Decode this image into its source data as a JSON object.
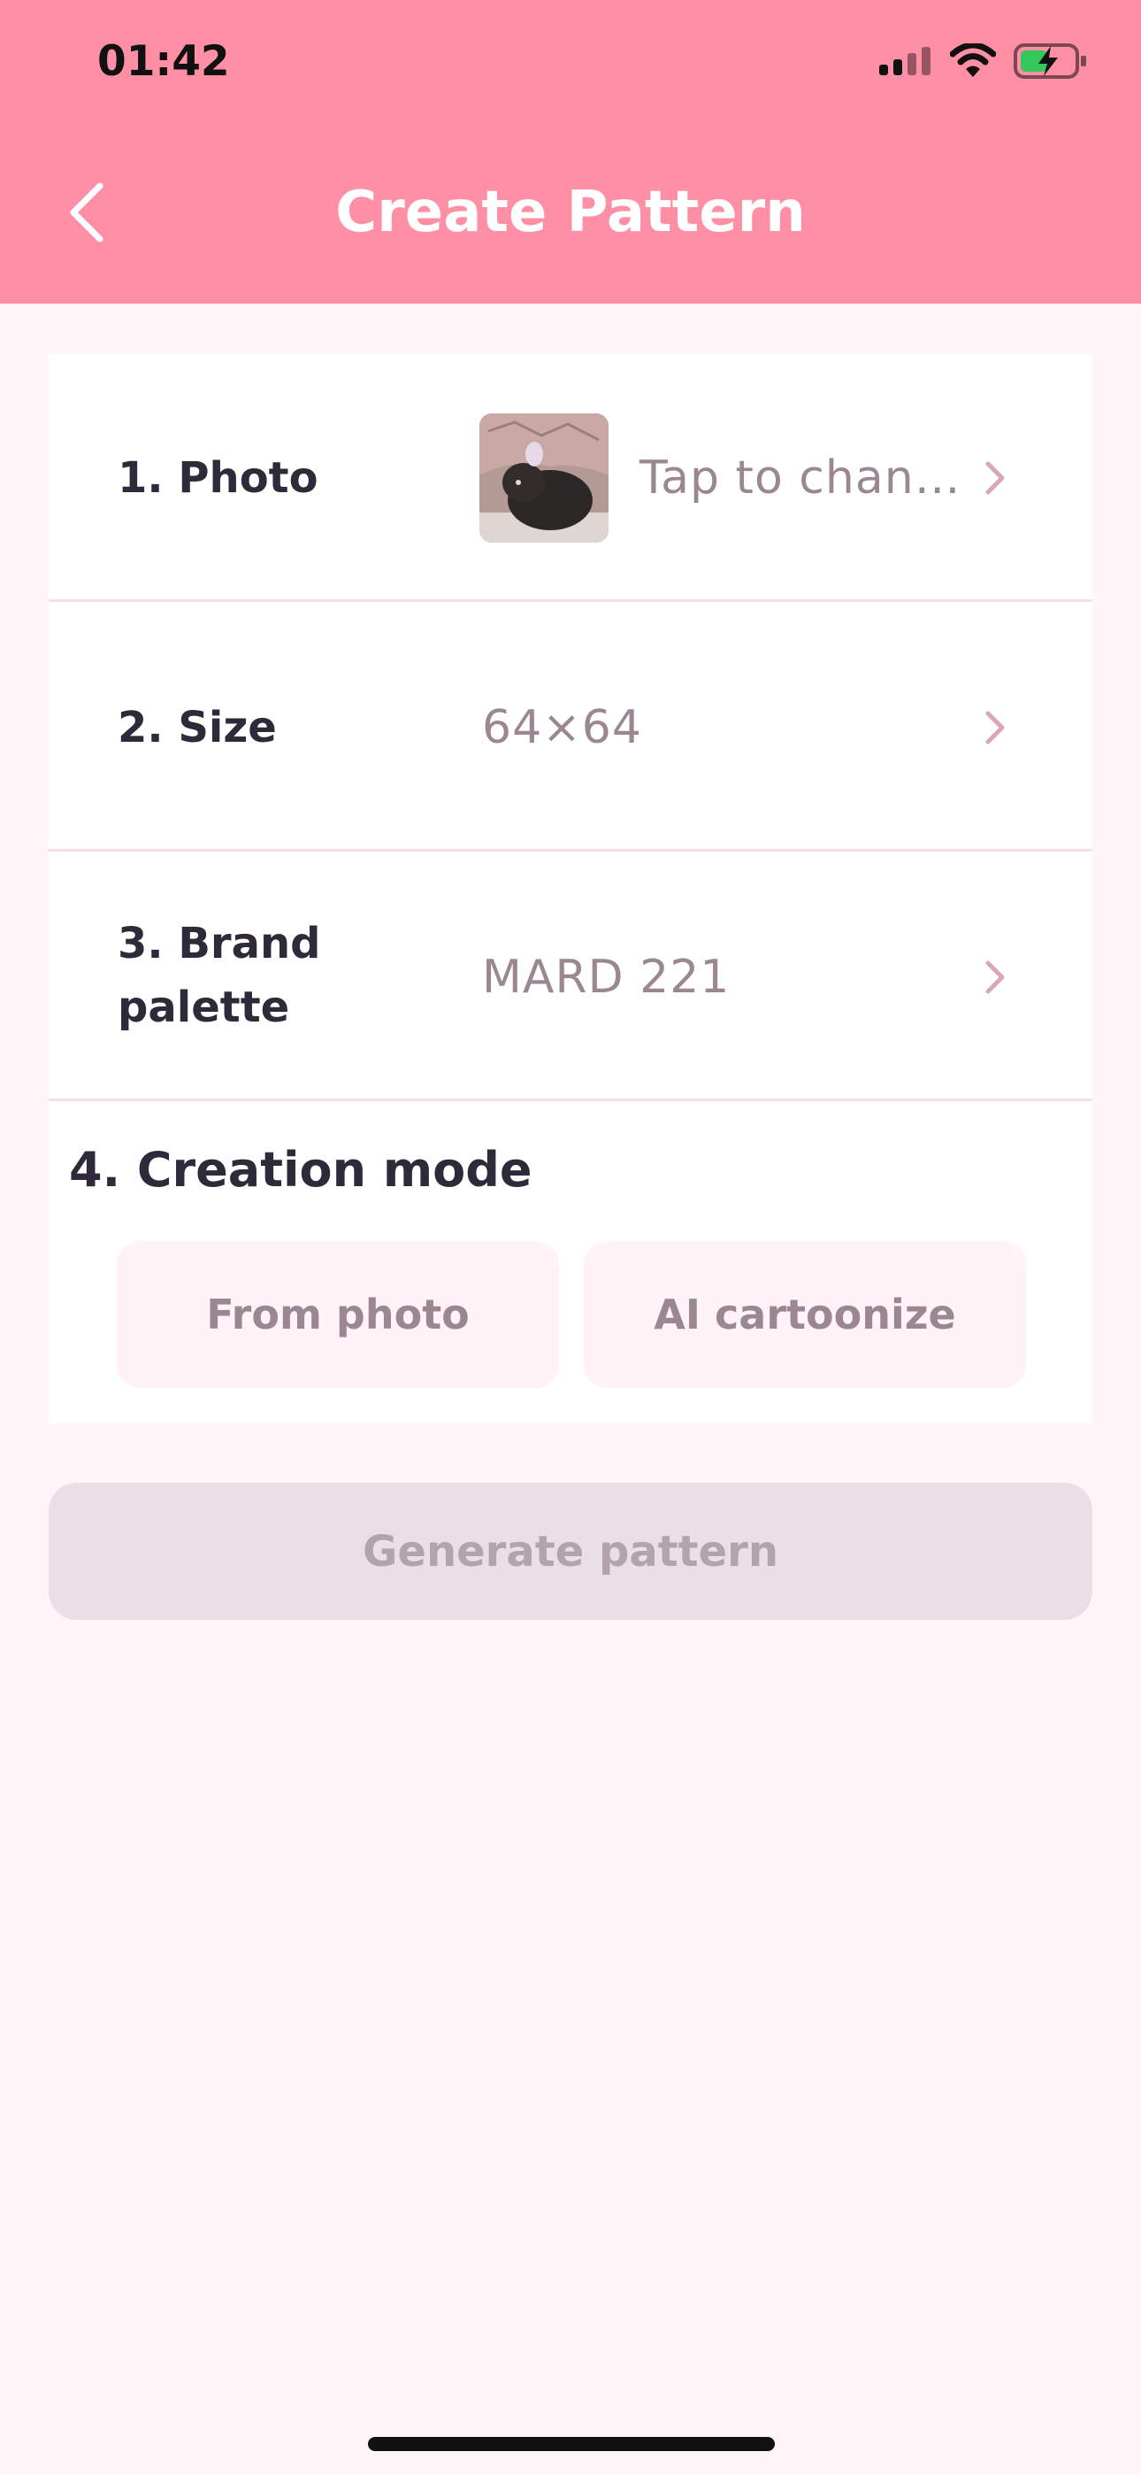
{
  "status_bar": {
    "time": "01:42"
  },
  "header": {
    "title": "Create Pattern",
    "back_icon": "chevron-left-icon"
  },
  "rows": [
    {
      "label": "1. Photo",
      "value": "Tap to chan…"
    },
    {
      "label": "2. Size",
      "value": "64×64"
    },
    {
      "label": "3. Brand palette",
      "value": "MARD 221"
    }
  ],
  "creation_mode": {
    "title": "4. Creation mode",
    "options": [
      "From photo",
      "AI cartoonize"
    ]
  },
  "generate_button": {
    "label": "Generate pattern",
    "enabled": false
  },
  "colors": {
    "header_bg": "#ff8fa5",
    "page_bg": "#fff5f9",
    "muted_text": "#9a8791"
  }
}
